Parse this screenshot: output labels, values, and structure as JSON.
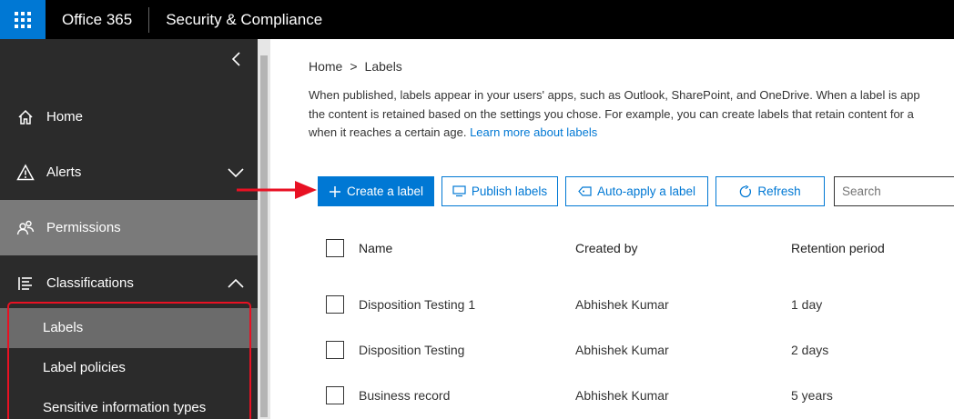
{
  "topbar": {
    "brand": "Office 365",
    "app_title": "Security & Compliance"
  },
  "sidebar": {
    "items": [
      {
        "label": "Home",
        "icon": "home-icon"
      },
      {
        "label": "Alerts",
        "icon": "alert-icon"
      },
      {
        "label": "Permissions",
        "icon": "people-icon"
      },
      {
        "label": "Classifications",
        "icon": "list-icon"
      }
    ],
    "sub_items": [
      {
        "label": "Labels"
      },
      {
        "label": "Label policies"
      },
      {
        "label": "Sensitive information types"
      }
    ]
  },
  "breadcrumb": {
    "home": "Home",
    "separator": ">",
    "current": "Labels"
  },
  "description": {
    "line1": "When published, labels appear in your users' apps, such as Outlook, SharePoint, and OneDrive. When a label is app",
    "line2": "the content is retained based on the settings you chose. For example, you can create labels that retain content for a",
    "line3": "when it reaches a certain age.",
    "learn_more": "Learn more about labels"
  },
  "toolbar": {
    "create_label": "Create a label",
    "publish_labels": "Publish labels",
    "auto_apply": "Auto-apply a label",
    "refresh": "Refresh",
    "search_placeholder": "Search"
  },
  "table": {
    "columns": [
      "Name",
      "Created by",
      "Retention period"
    ],
    "rows": [
      {
        "name": "Disposition Testing 1",
        "created_by": "Abhishek Kumar",
        "retention": "1 day"
      },
      {
        "name": "Disposition Testing",
        "created_by": "Abhishek Kumar",
        "retention": "2 days"
      },
      {
        "name": "Business record",
        "created_by": "Abhishek Kumar",
        "retention": "5 years"
      }
    ]
  },
  "colors": {
    "accent": "#0078d4",
    "annotation": "#e81123",
    "sidebar_bg": "#2b2b2b"
  }
}
